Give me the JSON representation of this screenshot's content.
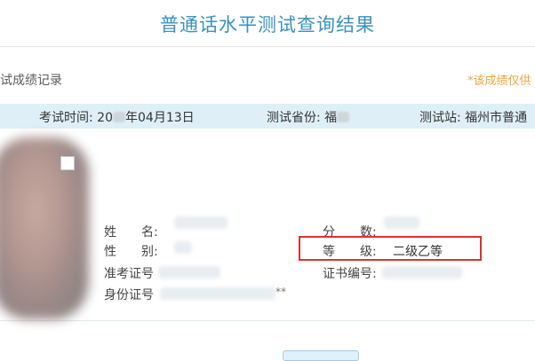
{
  "page": {
    "title": "普通话水平测试查询结果"
  },
  "section": {
    "label": "试成绩记录",
    "notice": "*该成绩仅供"
  },
  "info_bar": {
    "exam_time_label": "考试时间:",
    "exam_time_prefix": "20",
    "exam_time_suffix": "年04月13日",
    "province_label": "测试省份:",
    "province_value": "福",
    "station_label": "测试站:",
    "station_value": "福州市普通"
  },
  "record": {
    "name_label": "姓　　名:",
    "gender_label": "性　　别:",
    "ticket_label": "准考证号",
    "id_label": "身份证号",
    "id_tail": "**",
    "score_label": "分　　数:",
    "grade_label": "等　　级:",
    "grade_value": "二级乙等",
    "cert_label": "证书编号:"
  },
  "colors": {
    "title": "#3a92bf",
    "notice": "#f0a33c",
    "bar_bg": "#dfeff7",
    "highlight_border": "#e0302f"
  }
}
